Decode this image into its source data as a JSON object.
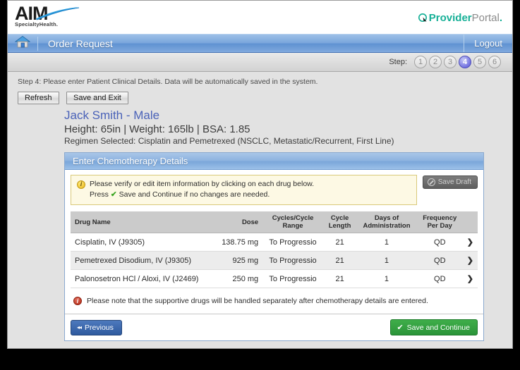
{
  "brand": {
    "aim_name": "AIM",
    "aim_tagline": "SpecialtyHealth.",
    "portal_provider": "Provider",
    "portal_portal": "Portal",
    "portal_dot": ".",
    "accent_blue": "#5f92d2",
    "accent_green": "#2b9439",
    "accent_teal": "#17b097"
  },
  "nav": {
    "home_icon": "home-icon",
    "title": "Order Request",
    "logout": "Logout"
  },
  "steps": {
    "label": "Step:",
    "items": [
      "1",
      "2",
      "3",
      "4",
      "5",
      "6"
    ],
    "active": "4"
  },
  "page": {
    "instruction": "Step 4: Please enter Patient Clinical Details. Data will be automatically saved in the system.",
    "refresh_label": "Refresh",
    "save_exit_label": "Save and Exit"
  },
  "patient": {
    "name": "Jack Smith - Male",
    "vitals": "Height: 65in  |  Weight: 165lb  |  BSA: 1.85",
    "regimen": "Regimen Selected: Cisplatin and Pemetrexed (NSCLC, Metastatic/Recurrent, First Line)"
  },
  "panel": {
    "title": "Enter Chemotherapy Details",
    "alert_line1": "Please verify or edit item information by clicking on each drug below.",
    "alert_press": "Press",
    "alert_check": "✔",
    "alert_line2": "Save and Continue if no changes are needed.",
    "save_draft_label": "Save Draft",
    "footnote": "Please note that the supportive drugs will be handled separately after chemotherapy details are entered."
  },
  "table": {
    "headers": {
      "drug_name": "Drug Name",
      "dose": "Dose",
      "cycles_line1": "Cycles/Cycle",
      "cycles_line2": "Range",
      "length_line1": "Cycle",
      "length_line2": "Length",
      "days_line1": "Days of",
      "days_line2": "Administration",
      "freq_line1": "Frequency",
      "freq_line2": "Per Day"
    },
    "rows": [
      {
        "drug_name": "Cisplatin, IV (J9305)",
        "dose": "138.75 mg",
        "cycles": "To Progressio",
        "cycle_length": "21",
        "days": "1",
        "frequency": "QD",
        "arrow": "❯"
      },
      {
        "drug_name": "Pemetrexed Disodium, IV (J9305)",
        "dose": "925 mg",
        "cycles": "To Progressio",
        "cycle_length": "21",
        "days": "1",
        "frequency": "QD",
        "arrow": "❯"
      },
      {
        "drug_name": "Palonosetron HCl / Aloxi, IV (J2469)",
        "dose": "250 mg",
        "cycles": "To Progressio",
        "cycle_length": "21",
        "days": "1",
        "frequency": "QD",
        "arrow": "❯"
      }
    ]
  },
  "footer": {
    "previous_label": "Previous",
    "previous_icon": "◂◂",
    "continue_label": "Save and Continue",
    "continue_icon": "✔"
  }
}
